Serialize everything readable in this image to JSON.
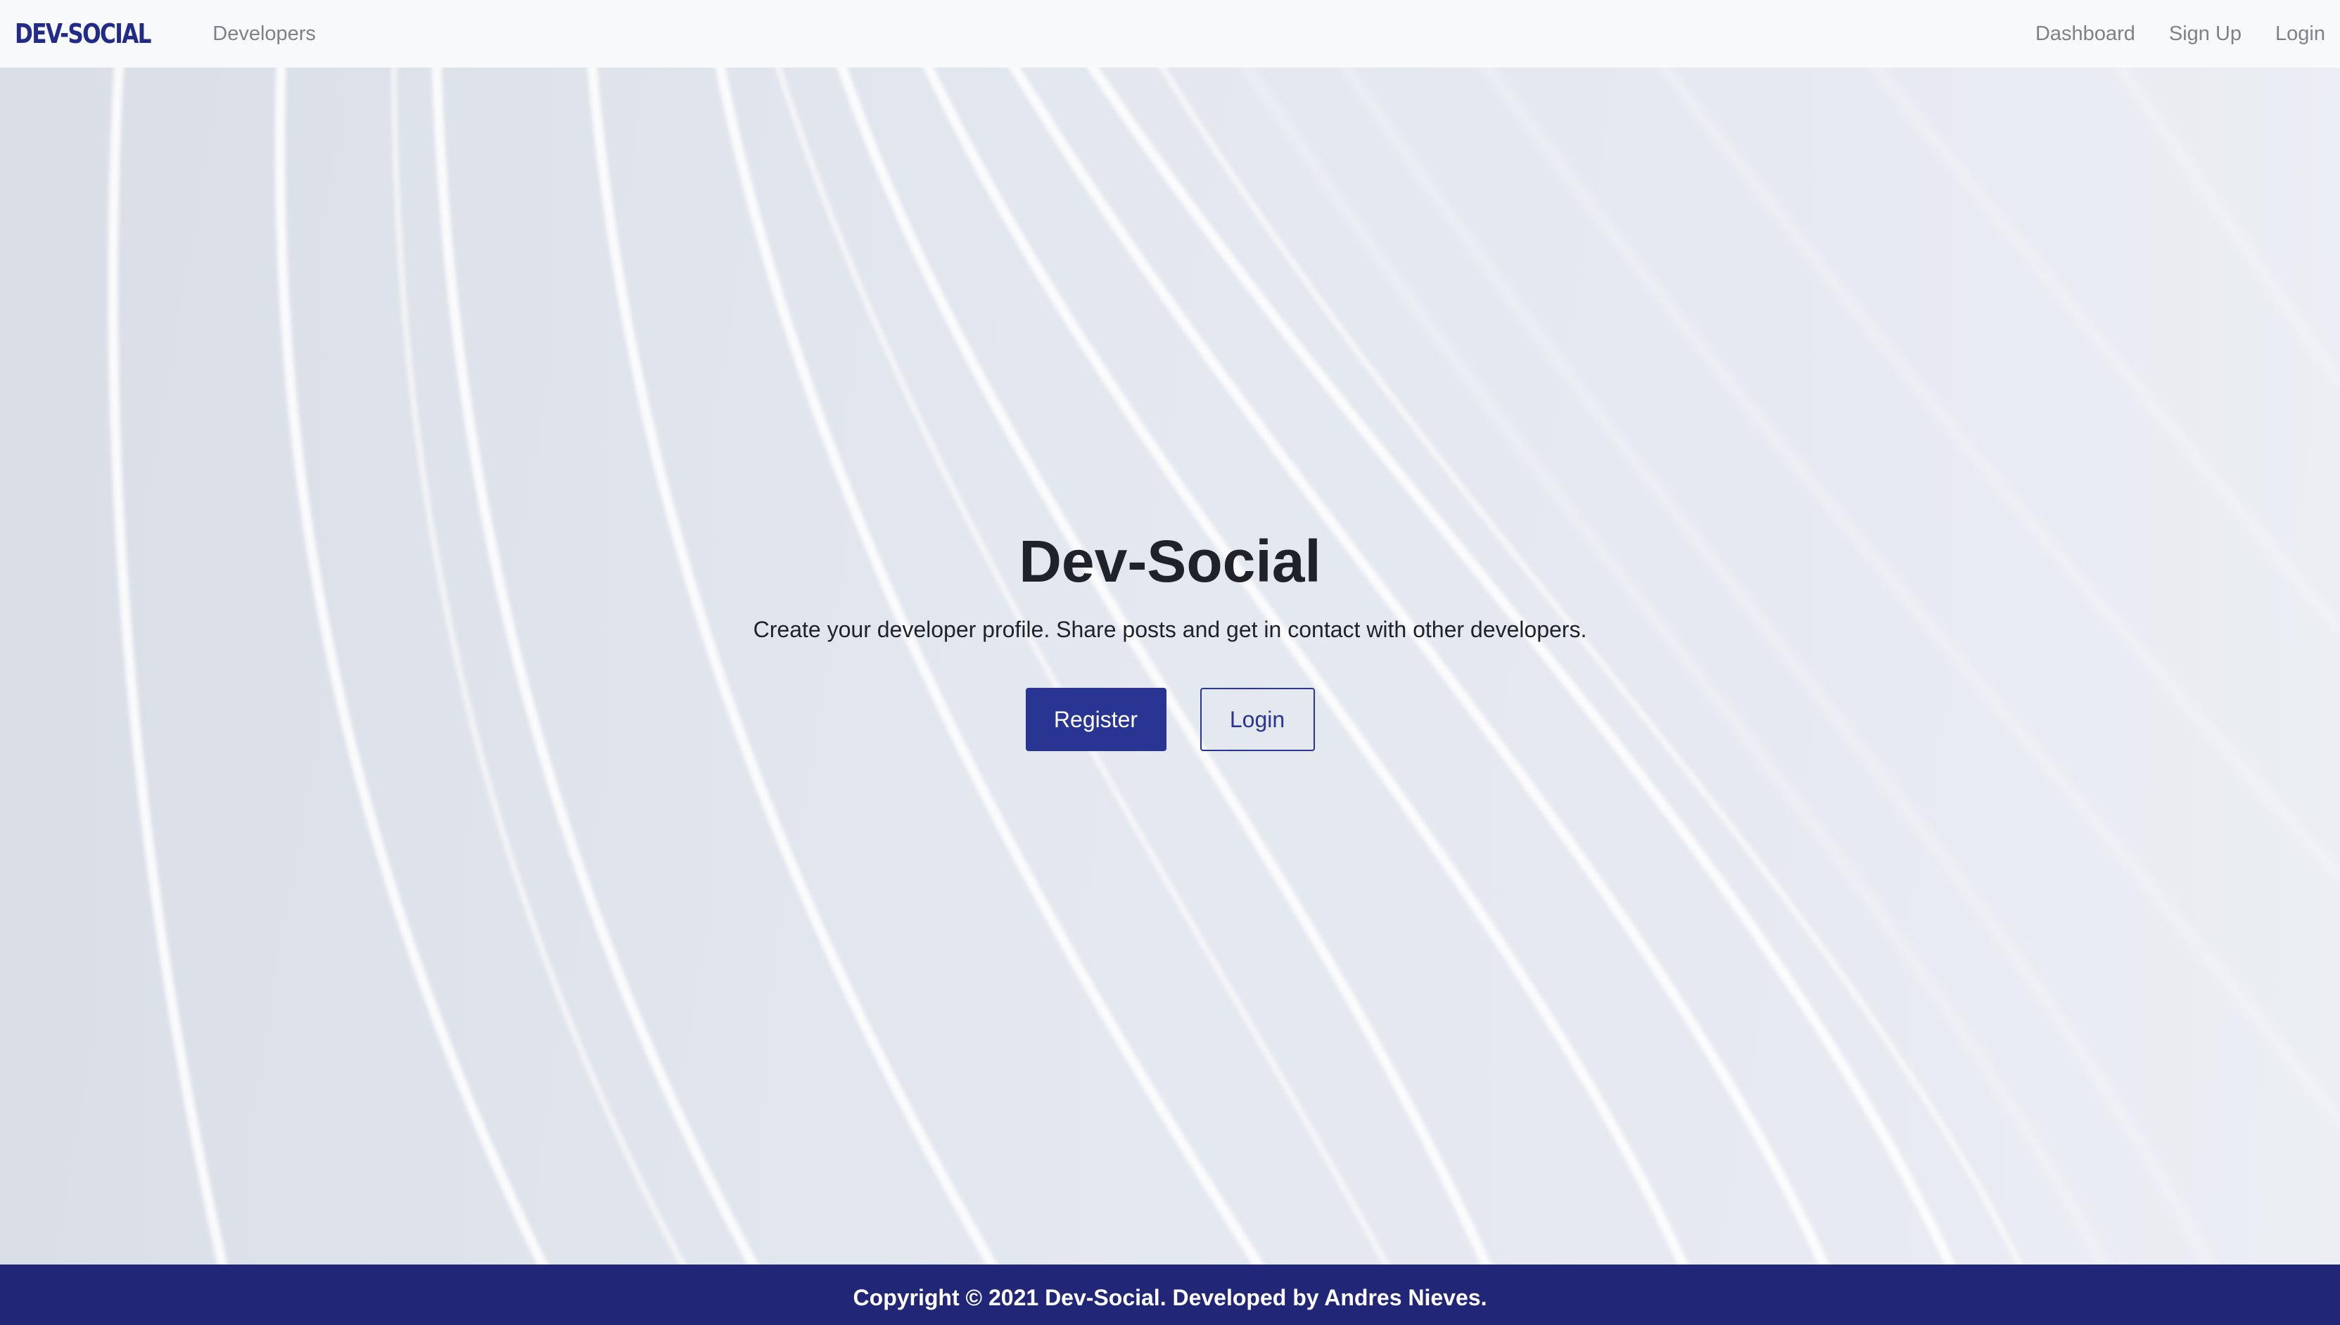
{
  "navbar": {
    "brand": "DEV-SOCIAL",
    "left_links": [
      "Developers"
    ],
    "right_links": [
      "Dashboard",
      "Sign Up",
      "Login"
    ]
  },
  "hero": {
    "title": "Dev-Social",
    "lead": "Create your developer profile. Share posts and get in contact with other developers.",
    "register_label": "Register",
    "login_label": "Login"
  },
  "footer": {
    "text": "Copyright © 2021 Dev-Social. Developed by Andres Nieves."
  },
  "colors": {
    "brand": "#232b88",
    "primary": "#283593",
    "footer_bg": "#222677",
    "navbar_bg": "#f8f9fa"
  }
}
